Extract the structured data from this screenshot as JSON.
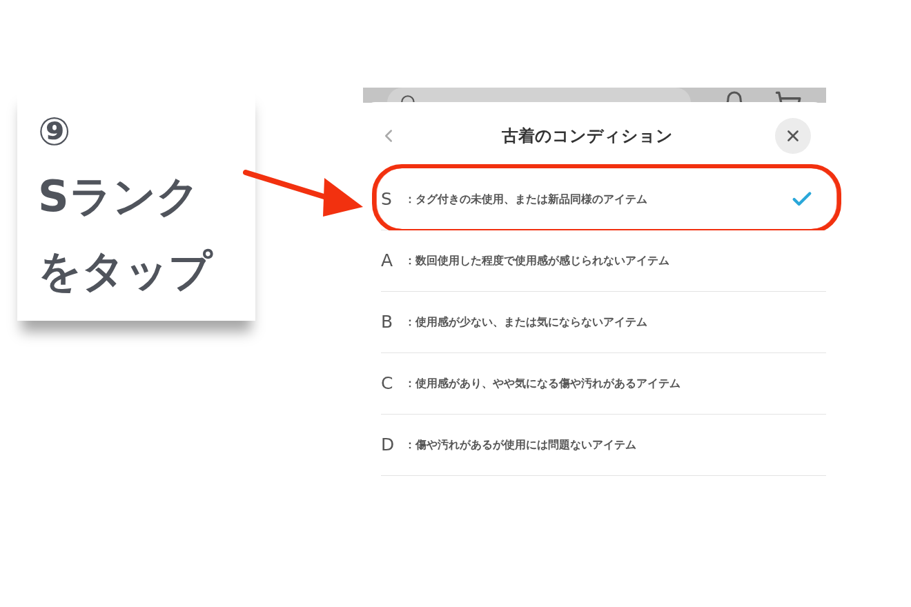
{
  "callout": {
    "step": "⑨",
    "lines": [
      "Sランク",
      "をタップ"
    ]
  },
  "sheet": {
    "title": "古着のコンディション",
    "options": [
      {
        "grade": "S",
        "description": "：タグ付きの未使用、または新品同様のアイテム",
        "selected": true
      },
      {
        "grade": "A",
        "description": "：数回使用した程度で使用感が感じられないアイテム",
        "selected": false
      },
      {
        "grade": "B",
        "description": "：使用感が少ない、または気にならないアイテム",
        "selected": false
      },
      {
        "grade": "C",
        "description": "：使用感があり、やや気になる傷や汚れがあるアイテム",
        "selected": false
      },
      {
        "grade": "D",
        "description": "：傷や汚れがあるが使用には問題ないアイテム",
        "selected": false
      }
    ]
  }
}
